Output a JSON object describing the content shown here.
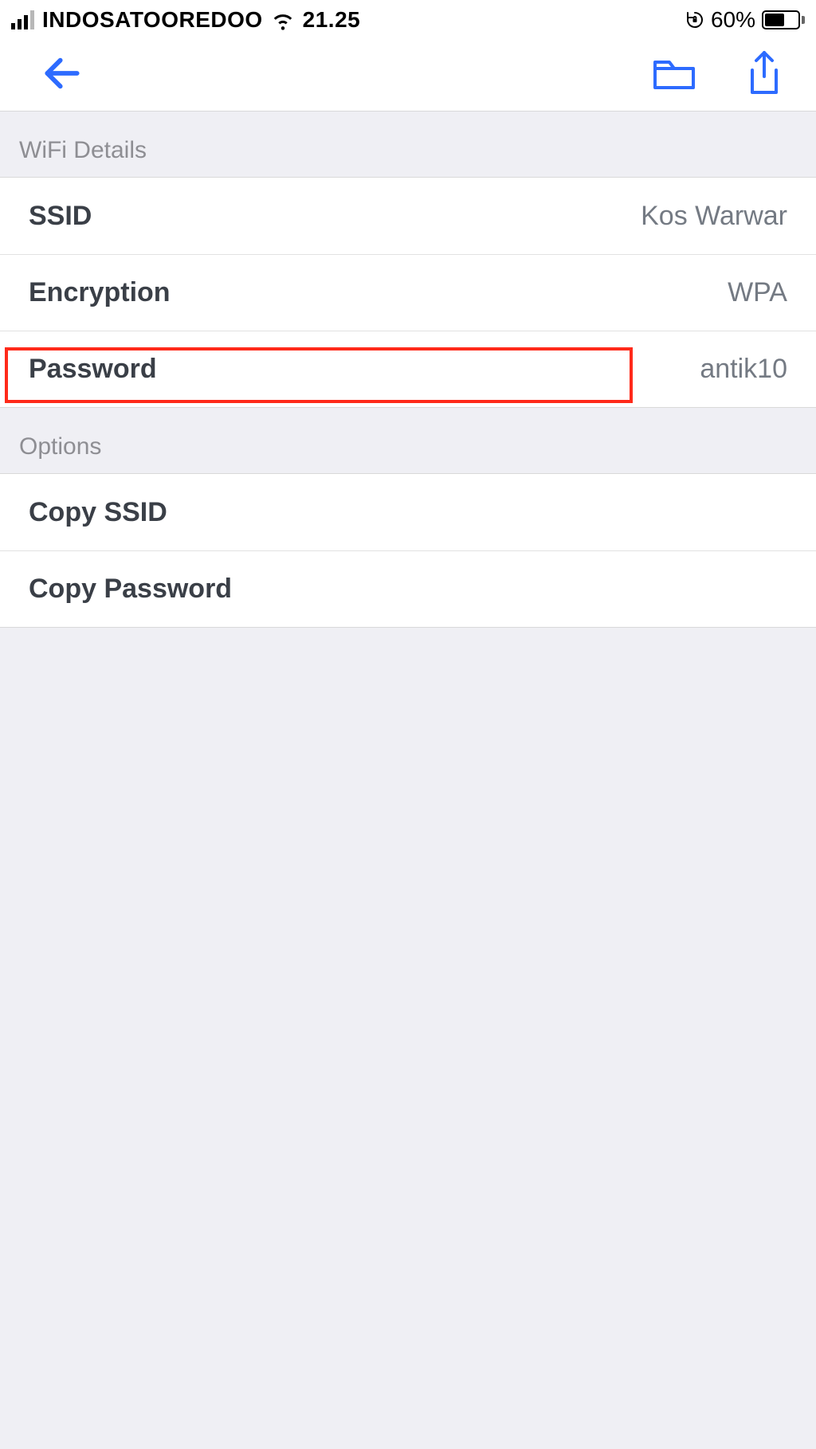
{
  "status_bar": {
    "carrier": "INDOSATOOREDOO",
    "time": "21.25",
    "battery_percent": "60%"
  },
  "sections": {
    "wifi_details": {
      "title": "WiFi Details",
      "rows": {
        "ssid": {
          "label": "SSID",
          "value": "Kos Warwar"
        },
        "encryption": {
          "label": "Encryption",
          "value": "WPA"
        },
        "password": {
          "label": "Password",
          "value": "antik10"
        }
      }
    },
    "options": {
      "title": "Options",
      "rows": {
        "copy_ssid": {
          "label": "Copy SSID"
        },
        "copy_password": {
          "label": "Copy Password"
        }
      }
    }
  }
}
